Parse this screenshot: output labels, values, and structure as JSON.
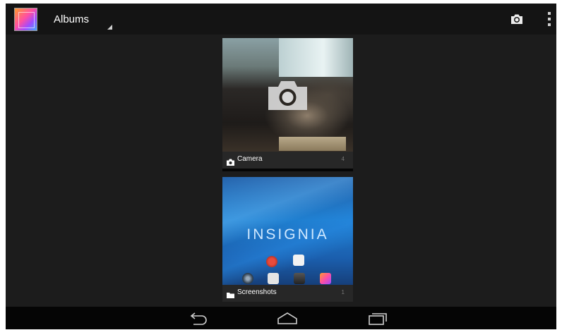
{
  "action_bar": {
    "title": "Albums",
    "app_icon": "gallery-app-icon",
    "actions": [
      "camera-icon",
      "overflow-menu-icon"
    ]
  },
  "albums": [
    {
      "name": "Camera",
      "count": "4",
      "type_icon": "camera-icon",
      "overlay_icon": "camera-icon"
    },
    {
      "name": "Screenshots",
      "count": "1",
      "type_icon": "folder-icon",
      "thumbnail_text": "INSIGNIA"
    }
  ],
  "nav_bar": {
    "buttons": [
      "back-icon",
      "home-icon",
      "recent-apps-icon"
    ]
  },
  "colors": {
    "action_bar": "#141414",
    "background": "#1c1c1c",
    "nav_bar": "#050505",
    "text": "#ffffff"
  }
}
